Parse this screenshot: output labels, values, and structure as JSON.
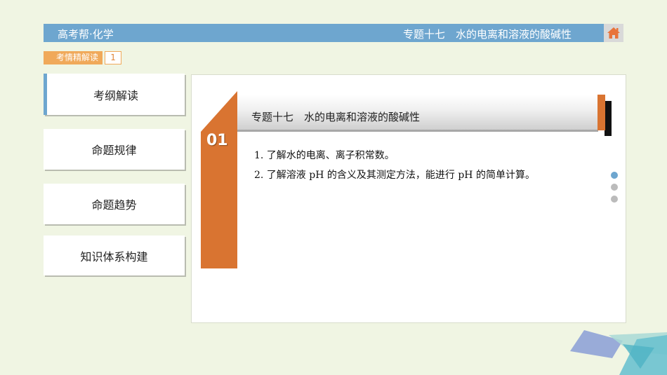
{
  "header": {
    "app_title": "高考帮·化学",
    "topic_title": "专题十七　水的电离和溶液的酸碱性",
    "home_icon": "home-icon"
  },
  "section_tag": {
    "label": "考情精解读",
    "page_number": "1"
  },
  "nav": {
    "items": [
      {
        "label": "考纲解读",
        "active": true
      },
      {
        "label": "命题规律",
        "active": false
      },
      {
        "label": "命题趋势",
        "active": false
      },
      {
        "label": "知识体系构建",
        "active": false
      }
    ]
  },
  "panel": {
    "number": "01",
    "title": "专题十七　水的电离和溶液的酸碱性",
    "lines": [
      "1. 了解水的电离、离子积常数。",
      "2. 了解溶液 pH 的含义及其测定方法，能进行 pH 的简单计算。"
    ]
  },
  "pager": {
    "count": 3,
    "active_index": 0
  },
  "colors": {
    "accent_blue": "#6ea6cf",
    "accent_orange": "#d97431",
    "tag_orange": "#f0a95a"
  }
}
